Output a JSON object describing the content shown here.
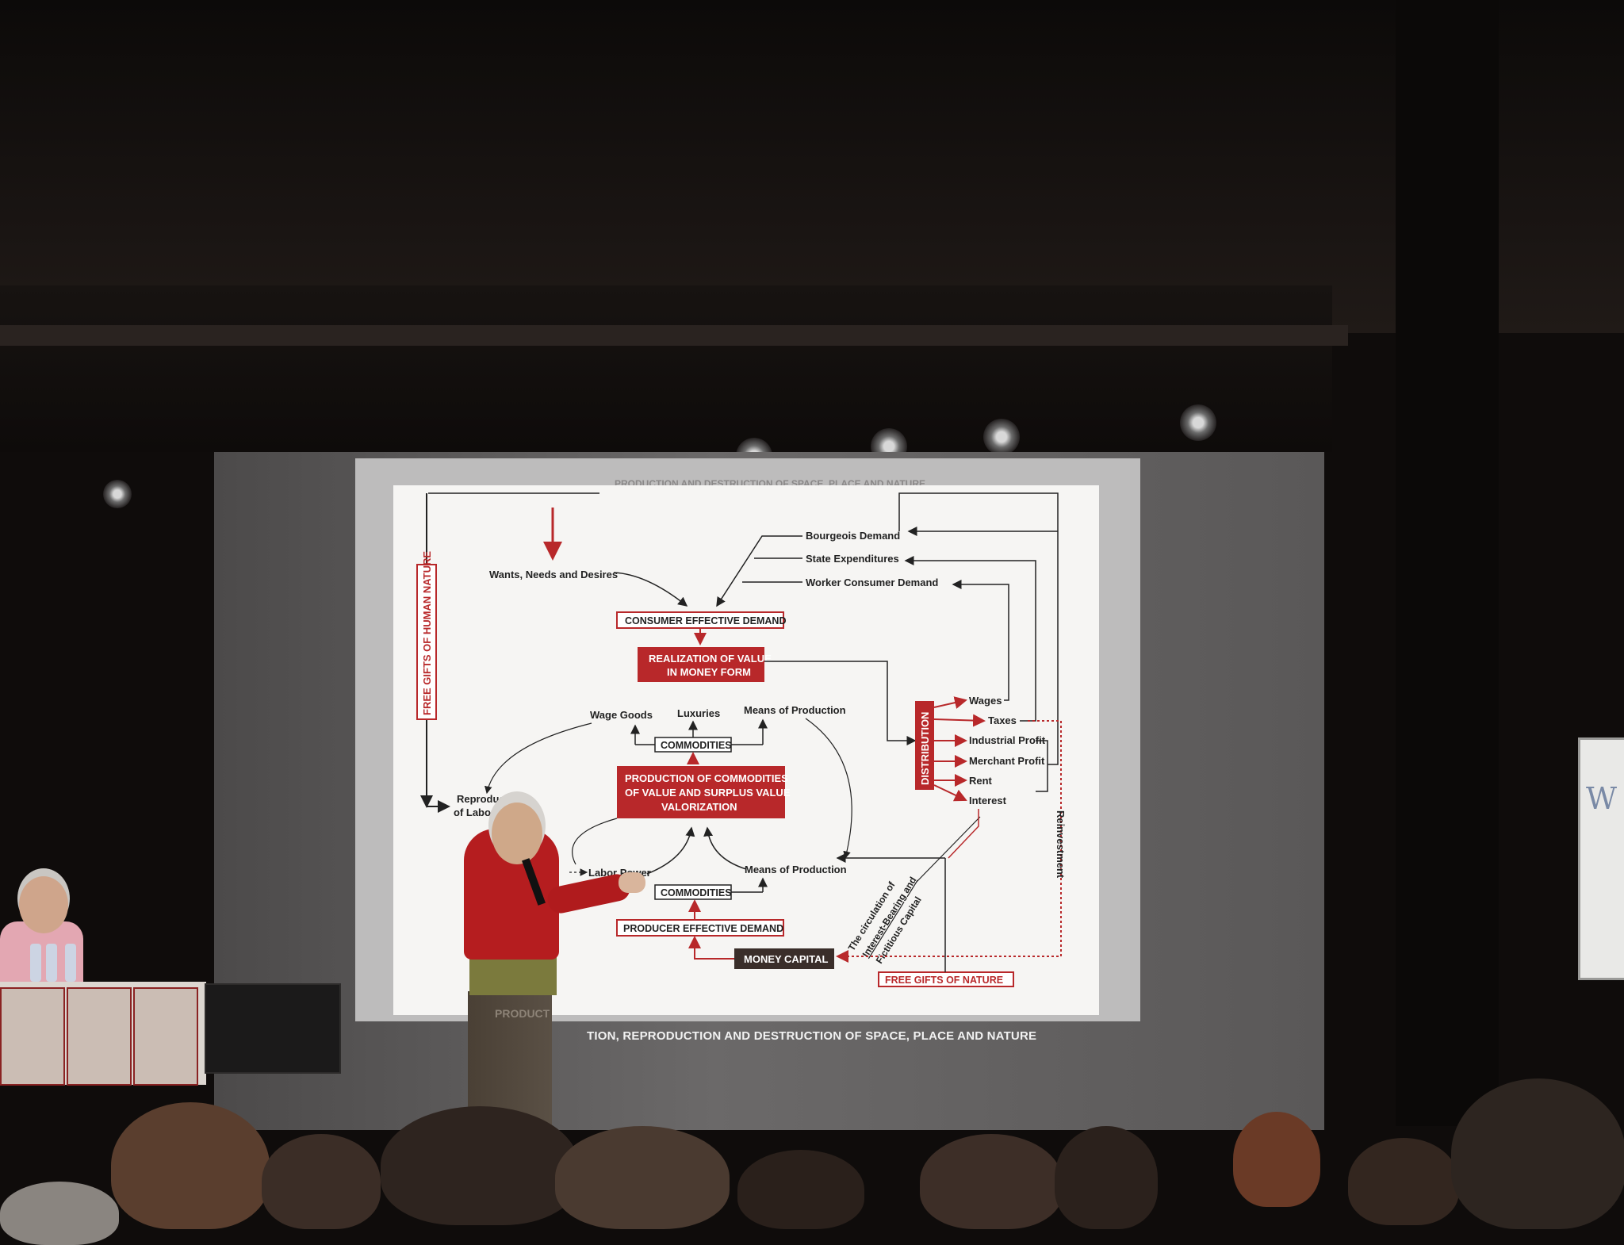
{
  "slide": {
    "header_strip": "PRODUCTION AND DESTRUCTION OF SPACE, PLACE AND NATURE",
    "caption": "TION, REPRODUCTION AND DESTRUCTION OF SPACE, PLACE AND NATURE",
    "side_label": "FREE GIFTS OF HUMAN NATURE",
    "wants": "Wants, Needs and Desires",
    "bourgeois": "Bourgeois Demand",
    "state": "State Expenditures",
    "worker": "Worker Consumer Demand",
    "consumer_demand": "CONSUMER EFFECTIVE DEMAND",
    "realization_1": "REALIZATION OF VALUE",
    "realization_2": "IN MONEY FORM",
    "wage_goods": "Wage Goods",
    "luxuries": "Luxuries",
    "means_top": "Means of Production",
    "commodities_top": "COMMODITIES",
    "production_1": "PRODUCTION OF COMMODITIES",
    "production_2": "OF VALUE AND SURPLUS VALUE",
    "production_3": "VALORIZATION",
    "reproduction_1": "Reproduction",
    "reproduction_2": "of Labor P",
    "labor_power": "Labor Power",
    "means_bottom": "Means of Production",
    "commodities_bottom": "COMMODITIES",
    "producer_demand": "PRODUCER EFFECTIVE DEMAND",
    "money_capital": "MONEY CAPITAL",
    "free_gifts_nature": "FREE GIFTS OF NATURE",
    "circulation_1": "The circulation of",
    "circulation_2": "Interest-Bearing and",
    "circulation_3": "Fictitious Capital",
    "distribution": "DISTRIBUTION",
    "wages": "Wages",
    "taxes": "Taxes",
    "industrial": "Industrial Profit",
    "merchant": "Merchant Profit",
    "rent": "Rent",
    "interest": "Interest",
    "reinvestment": "Reinvestment"
  },
  "scene": {
    "speaker_trousers_text": "PRODUCT",
    "whiteboard_text": "W"
  },
  "colors": {
    "diagram_red": "#b8282a",
    "slide_bg": "#f6f5f3",
    "screen": "#5e5c5c"
  }
}
